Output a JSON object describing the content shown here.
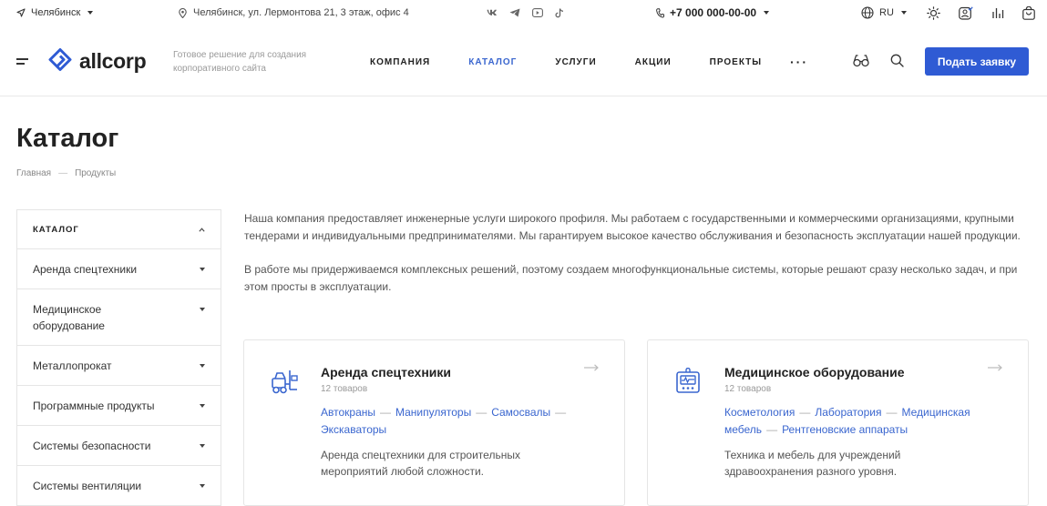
{
  "topbar": {
    "city": "Челябинск",
    "address": "Челябинск, ул. Лермонтова 21, 3 этаж, офис 4",
    "phone": "+7 000 000-00-00",
    "lang": "RU"
  },
  "header": {
    "logo": "allcorp",
    "tagline": "Готовое решение для создания корпоративного сайта",
    "nav": [
      "КОМПАНИЯ",
      "КАТАЛОГ",
      "УСЛУГИ",
      "АКЦИИ",
      "ПРОЕКТЫ"
    ],
    "more": "···",
    "cta": "Подать заявку"
  },
  "page": {
    "title": "Каталог",
    "breadcrumb": [
      "Главная",
      "Продукты"
    ],
    "breadcrumb_sep": "—"
  },
  "sidebar": {
    "heading": "КАТАЛОГ",
    "items": [
      "Аренда спецтехники",
      "Медицинское оборудование",
      "Металлопрокат",
      "Программные продукты",
      "Системы безопасности",
      "Системы вентиляции"
    ]
  },
  "description": {
    "p1": "Наша компания предоставляет инженерные услуги широкого профиля. Мы работаем с государственными и коммерческими организациями, крупными тендерами и индивидуальными предпринимателями. Мы гарантируем высокое качество обслуживания и безопасность эксплуатации нашей продукции.",
    "p2": "В работе мы придерживаемся комплексных решений, поэтому создаем многофункциональные системы, которые решают сразу несколько задач, и при этом просты в эксплуатации."
  },
  "cards": [
    {
      "title": "Аренда спецтехники",
      "count": "12 товаров",
      "tags": [
        "Автокраны",
        "Манипуляторы",
        "Самосвалы",
        "Экскаваторы"
      ],
      "desc": "Аренда спецтехники для строительных мероприятий любой сложности."
    },
    {
      "title": "Медицинское оборудование",
      "count": "12 товаров",
      "tags": [
        "Косметология",
        "Лаборатория",
        "Медицинская мебель",
        "Рентгеновские аппараты"
      ],
      "desc": "Техника и мебель для учреждений здравоохранения разного уровня."
    }
  ],
  "colors": {
    "accent": "#2f5bd4",
    "link": "#3a66cf"
  },
  "icons": [
    "location-icon",
    "pin-icon",
    "vk-icon",
    "telegram-icon",
    "youtube-icon",
    "tiktok-icon",
    "phone-icon",
    "globe-icon",
    "sun-icon",
    "user-icon",
    "chart-icon",
    "bag-icon",
    "menu-icon",
    "eye-icon",
    "search-icon",
    "arrow-right-icon",
    "forklift-icon",
    "medical-device-icon"
  ]
}
